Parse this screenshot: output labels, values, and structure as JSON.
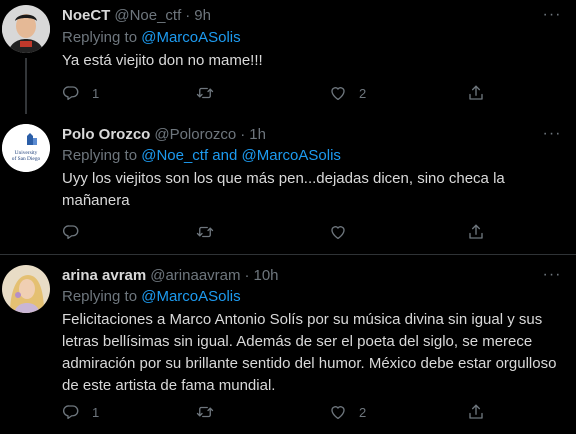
{
  "tweets": [
    {
      "name": "NoeCT",
      "handle": "@Noe_ctf",
      "dot": "·",
      "time": "9h",
      "reply_prefix": "Replying to ",
      "reply_to": "@MarcoASolis",
      "text": "Ya está viejito don no mame!!!",
      "replies": "1",
      "retweets": "",
      "likes": "2"
    },
    {
      "name": "Polo Orozco",
      "handle": "@Polorozco",
      "dot": "·",
      "time": "1h",
      "reply_prefix": "Replying to ",
      "reply_to": "@Noe_ctf and @MarcoASolis",
      "text": "Uyy los viejitos son los que más pen...dejadas dicen, sino checa la mañanera",
      "replies": "",
      "retweets": "",
      "likes": "",
      "avatar_text_1": "University",
      "avatar_text_2": "of San Diego"
    },
    {
      "name": "arina avram",
      "handle": "@arinaavram",
      "dot": "·",
      "time": "10h",
      "reply_prefix": "Replying to ",
      "reply_to": "@MarcoASolis",
      "text": "Felicitaciones a Marco Antonio Solís por su música divina sin igual y sus letras bellísimas sin igual. Además de ser el poeta del siglo, se merece admiración por su brillante sentido del humor. México debe estar orgulloso de este artista de fama mundial.",
      "replies": "1",
      "retweets": "",
      "likes": "2"
    }
  ],
  "more_glyph": "···",
  "colors": {
    "background": "#000000",
    "text": "#d9d9d9",
    "secondary": "#6e767d",
    "link": "#1d9bf0",
    "divider": "#2f3336"
  }
}
